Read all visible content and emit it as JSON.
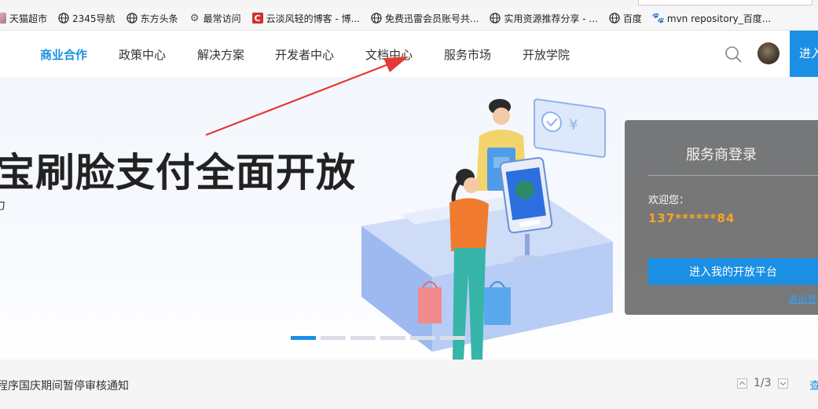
{
  "browser": {
    "bookmarks": [
      {
        "label": "天猫超市",
        "icon": "tmall-icon"
      },
      {
        "label": "2345导航",
        "icon": "globe-icon"
      },
      {
        "label": "东方头条",
        "icon": "globe-icon"
      },
      {
        "label": "最常访问",
        "icon": "gear-icon"
      },
      {
        "label": "云淡风轻的博客 - 博...",
        "icon": "csdn-icon"
      },
      {
        "label": "免费迅雷会员账号共...",
        "icon": "globe-icon"
      },
      {
        "label": "实用资源推荐分享 - ...",
        "icon": "globe-icon"
      },
      {
        "label": "百度",
        "icon": "globe-icon"
      },
      {
        "label": "mvn repository_百度...",
        "icon": "baidu-paw-icon"
      }
    ]
  },
  "header": {
    "nav": [
      {
        "label": "商业合作",
        "active": true
      },
      {
        "label": "政策中心",
        "active": false
      },
      {
        "label": "解决方案",
        "active": false
      },
      {
        "label": "开发者中心",
        "active": false
      },
      {
        "label": "文档中心",
        "active": false
      },
      {
        "label": "服务市场",
        "active": false
      },
      {
        "label": "开放学院",
        "active": false
      }
    ],
    "enter_label": "进入"
  },
  "hero": {
    "title": "宝刷脸支付全面开放",
    "subtitle": "力",
    "active_slide": 0,
    "slide_count": 6
  },
  "login": {
    "title": "服务商登录",
    "welcome": "欢迎您：",
    "account": "137******84",
    "platform_button": "进入我的开放平台",
    "logout": "退出登"
  },
  "notice": {
    "text": "程序国庆期间暂停审核通知",
    "page": "1/3",
    "more": "查"
  },
  "colors": {
    "accent": "#1a8fe3",
    "account": "#f5a623",
    "annotation_arrow": "#e53935"
  }
}
